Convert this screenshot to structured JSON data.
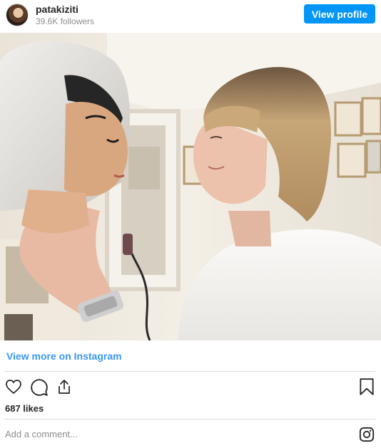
{
  "header": {
    "username": "patakiziti",
    "followers": "39.6K followers",
    "view_profile_label": "View profile"
  },
  "post": {
    "image_alt": "Instagram post photo"
  },
  "footer": {
    "view_more_label": "View more on Instagram",
    "likes": "687 likes",
    "comment_placeholder": "Add a comment..."
  },
  "colors": {
    "accent": "#0095f6",
    "link": "#3897f0",
    "muted": "#8e8e8e"
  },
  "icons": {
    "like": "heart-icon",
    "comment": "comment-icon",
    "share": "share-icon",
    "save": "bookmark-icon",
    "brand": "instagram-icon"
  }
}
